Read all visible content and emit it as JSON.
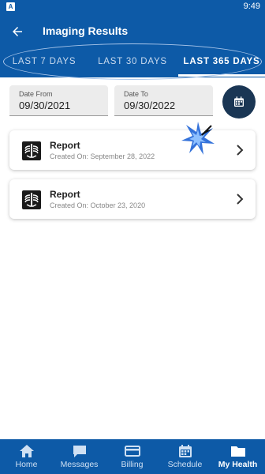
{
  "status_bar": {
    "time": "9:49",
    "app_badge": "A"
  },
  "header": {
    "title": "Imaging Results",
    "back_icon": "arrow-left-icon"
  },
  "tabs": [
    {
      "label": "LAST 7 DAYS",
      "selected": false
    },
    {
      "label": "LAST 30 DAYS",
      "selected": false
    },
    {
      "label": "LAST 365 DAYS",
      "selected": true
    }
  ],
  "filters": {
    "date_from": {
      "label": "Date From",
      "value": "09/30/2021"
    },
    "date_to": {
      "label": "Date To",
      "value": "09/30/2022"
    },
    "calendar_icon": "calendar-icon"
  },
  "reports": [
    {
      "title": "Report",
      "created": "Created On: September 28, 2022",
      "icon": "xray-icon"
    },
    {
      "title": "Report",
      "created": "Created On: October 23, 2020",
      "icon": "xray-icon"
    }
  ],
  "bottom_nav": [
    {
      "label": "Home",
      "icon": "home-icon",
      "active": false
    },
    {
      "label": "Messages",
      "icon": "messages-icon",
      "active": false
    },
    {
      "label": "Billing",
      "icon": "billing-icon",
      "active": false
    },
    {
      "label": "Schedule",
      "icon": "schedule-icon",
      "active": false
    },
    {
      "label": "My Health",
      "icon": "folder-icon",
      "active": true
    }
  ],
  "colors": {
    "primary": "#0d5aa7",
    "calendar_button": "#1a3654",
    "field_bg": "#ececec"
  }
}
